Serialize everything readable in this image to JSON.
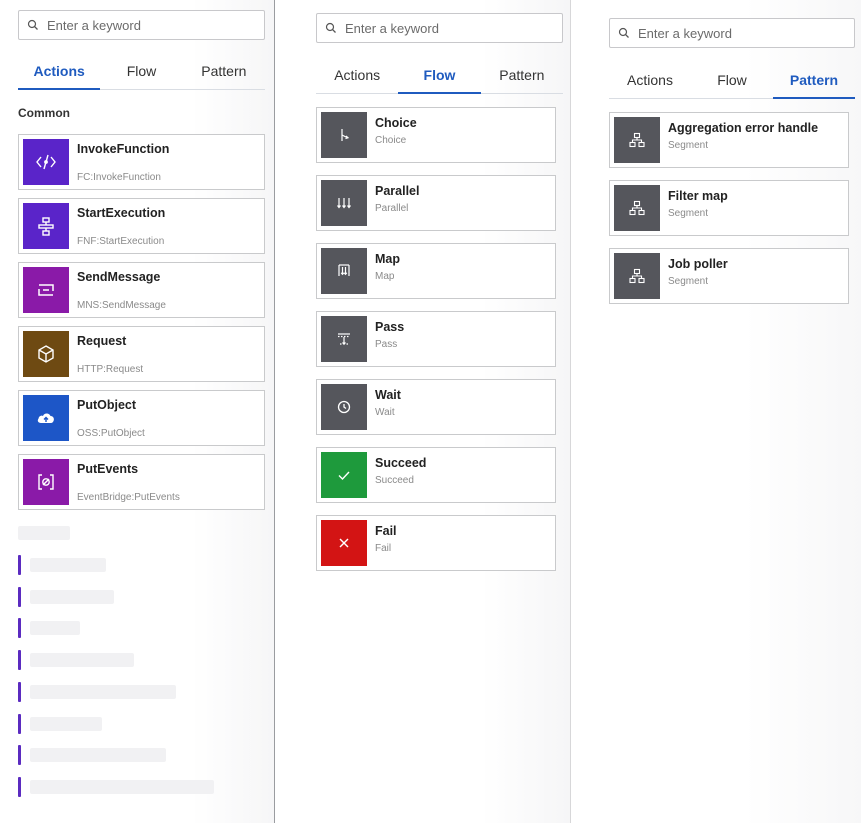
{
  "search": {
    "placeholder": "Enter a keyword"
  },
  "tabs": [
    "Actions",
    "Flow",
    "Pattern"
  ],
  "colors": {
    "active_tab": "#1f5bbf",
    "invoke_function": "#5a24c9",
    "start_execution": "#5a24c9",
    "send_message": "#8a1aa8",
    "request": "#6e4a12",
    "put_object": "#1d56c7",
    "put_events": "#8a1aa8",
    "flow_tile": "#55565c",
    "succeed": "#1e9a3c",
    "fail": "#d31414",
    "pattern_tile": "#55565c"
  },
  "actions_panel": {
    "section_title": "Common",
    "items": [
      {
        "title": "InvokeFunction",
        "subtitle": "FC:InvokeFunction",
        "icon": "function-icon"
      },
      {
        "title": "StartExecution",
        "subtitle": "FNF:StartExecution",
        "icon": "workflow-icon"
      },
      {
        "title": "SendMessage",
        "subtitle": "MNS:SendMessage",
        "icon": "message-icon"
      },
      {
        "title": "Request",
        "subtitle": "HTTP:Request",
        "icon": "cube-icon"
      },
      {
        "title": "PutObject",
        "subtitle": "OSS:PutObject",
        "icon": "cloud-upload-icon"
      },
      {
        "title": "PutEvents",
        "subtitle": "EventBridge:PutEvents",
        "icon": "event-icon"
      }
    ]
  },
  "flow_panel": {
    "items": [
      {
        "title": "Choice",
        "subtitle": "Choice",
        "icon": "branch-icon"
      },
      {
        "title": "Parallel",
        "subtitle": "Parallel",
        "icon": "parallel-icon"
      },
      {
        "title": "Map",
        "subtitle": "Map",
        "icon": "map-icon"
      },
      {
        "title": "Pass",
        "subtitle": "Pass",
        "icon": "pass-icon"
      },
      {
        "title": "Wait",
        "subtitle": "Wait",
        "icon": "clock-icon"
      },
      {
        "title": "Succeed",
        "subtitle": "Succeed",
        "icon": "check-icon"
      },
      {
        "title": "Fail",
        "subtitle": "Fail",
        "icon": "close-icon"
      }
    ]
  },
  "pattern_panel": {
    "items": [
      {
        "title": "Aggregation error handle",
        "subtitle": "Segment",
        "icon": "hierarchy-icon"
      },
      {
        "title": "Filter map",
        "subtitle": "Segment",
        "icon": "hierarchy-icon"
      },
      {
        "title": "Job poller",
        "subtitle": "Segment",
        "icon": "hierarchy-icon"
      }
    ]
  }
}
